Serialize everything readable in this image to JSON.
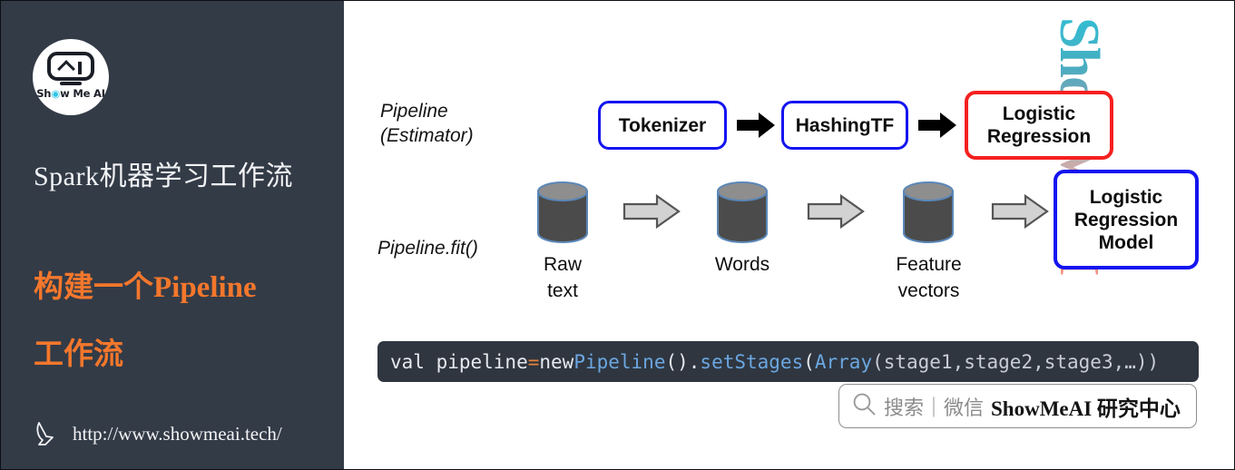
{
  "sidebar": {
    "logo": {
      "icon_name": "show-me-ai-robot-logo",
      "text_pre": "Sh",
      "text_eye": "◉",
      "text_post": "w Me AI"
    },
    "title": "Spark机器学习工作流",
    "subtitle_line1": "构建一个Pipeline",
    "subtitle_line2": "工作流",
    "url": "http://www.showmeai.tech/",
    "cursor_icon": "pointer-cursor-icon",
    "colors": {
      "background": "#333b47",
      "title": "#f2f3f5",
      "accent_orange": "#f4772c"
    }
  },
  "canvas": {
    "watermark": "ShowMeAI",
    "labels": {
      "pipeline_estimator": "Pipeline\n(Estimator)",
      "pipeline_fit": "Pipeline.fit()"
    },
    "stages": [
      {
        "label": "Tokenizer",
        "border_color": "#1414f0"
      },
      {
        "label": "HashingTF",
        "border_color": "#1414f0"
      },
      {
        "label": "Logistic\nRegression",
        "border_color": "#f52020"
      }
    ],
    "arrows_black": [
      "arrow-right-solid",
      "arrow-right-solid"
    ],
    "arrows_gray": [
      "arrow-right-outline",
      "arrow-right-outline",
      "arrow-right-outline"
    ],
    "data_nodes": [
      {
        "caption": "Raw\ntext",
        "icon": "database-cylinder-icon"
      },
      {
        "caption": "Words",
        "icon": "database-cylinder-icon"
      },
      {
        "caption": "Feature\nvectors",
        "icon": "database-cylinder-icon"
      }
    ],
    "model_box": {
      "label": "Logistic\nRegression\nModel",
      "border_color": "#1414f0"
    },
    "code": {
      "tokens": [
        {
          "text": "val pipeline ",
          "type": "plain"
        },
        {
          "text": "=",
          "type": "op"
        },
        {
          "text": " new ",
          "type": "plain"
        },
        {
          "text": "Pipeline",
          "type": "fn"
        },
        {
          "text": "()",
          "type": "plain"
        },
        {
          "text": ".",
          "type": "plain"
        },
        {
          "text": "setStages",
          "type": "fn"
        },
        {
          "text": "(",
          "type": "plain"
        },
        {
          "text": "Array",
          "type": "fn"
        },
        {
          "text": "(stage1,stage2,stage3,…))",
          "type": "ident"
        }
      ],
      "full_text": "val pipeline = new Pipeline().setStages(Array(stage1,stage2,stage3,…))",
      "background": "#2f3640"
    },
    "search": {
      "icon": "search-icon",
      "placeholder": "搜索｜微信",
      "brand": "ShowMeAI 研究中心"
    }
  }
}
